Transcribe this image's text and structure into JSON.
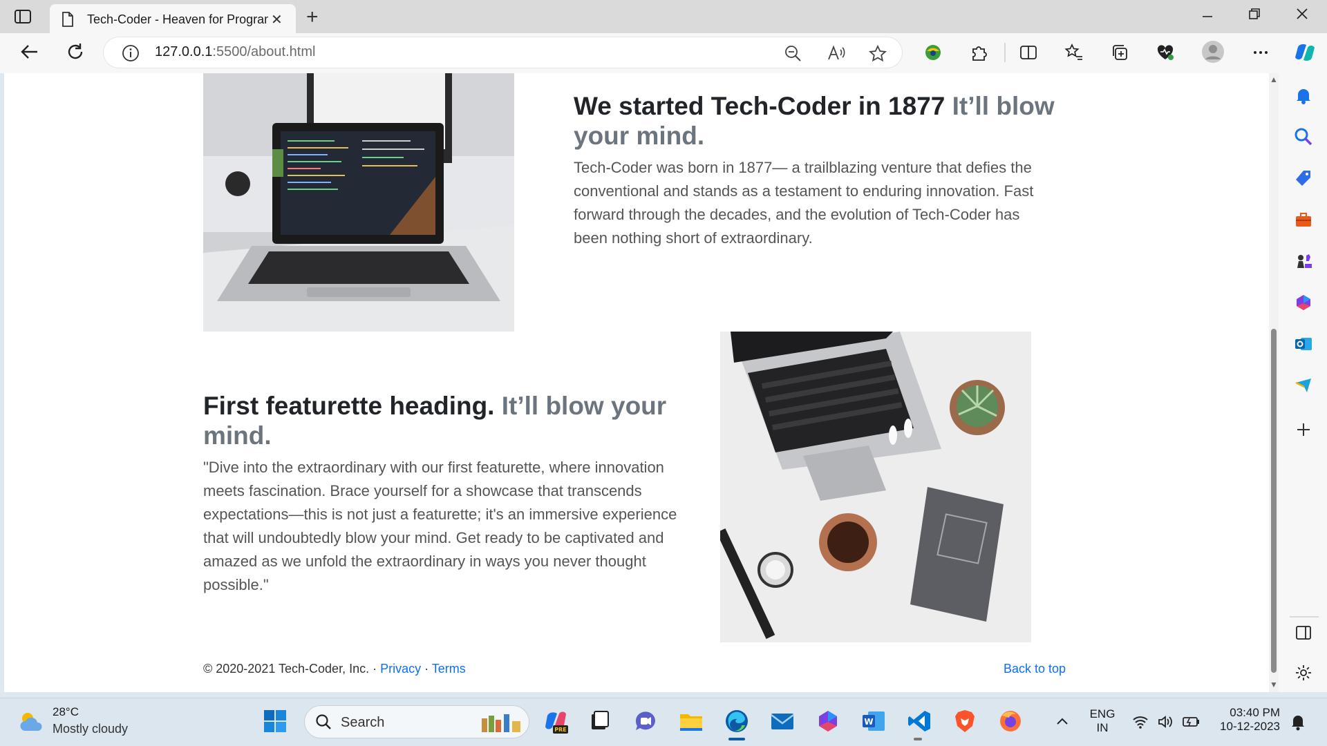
{
  "browser": {
    "tab_title": "Tech-Coder - Heaven for Programmers",
    "url_host": "127.0.0.1",
    "url_rest": ":5500/about.html",
    "new_tab_symbol": "+",
    "tab_close_symbol": "✕"
  },
  "page": {
    "section1": {
      "heading": "We started Tech-Coder in 1877",
      "heading_muted": "It’ll blow your mind.",
      "text": "Tech-Coder was born in 1877— a trailblazing venture that defies the conventional and stands as a testament to enduring innovation. Fast forward through the decades, and the evolution of Tech-Coder has been nothing short of extraordinary."
    },
    "section2": {
      "heading": "First featurette heading.",
      "heading_muted": "It’ll blow your mind.",
      "text": "\"Dive into the extraordinary with our first featurette, where innovation meets fascination. Brace yourself for a showcase that transcends expectations—this is not just a featurette; it's an immersive experience that will undoubtedly blow your mind. Get ready to be captivated and amazed as we unfold the extraordinary in ways you never thought possible.\""
    },
    "footer": {
      "copyright": "© 2020-2021 Tech-Coder, Inc. · ",
      "privacy": "Privacy",
      "separator": " · ",
      "terms": "Terms",
      "back_to_top": "Back to top"
    }
  },
  "taskbar": {
    "weather_temp": "28°C",
    "weather_desc": "Mostly cloudy",
    "search_label": "Search",
    "lang_top": "ENG",
    "lang_bottom": "IN",
    "time": "03:40 PM",
    "date": "10-12-2023"
  },
  "colors": {
    "link": "#0d6efd",
    "heading_muted": "#6c757d",
    "edge_blue": "#0c59a4"
  }
}
